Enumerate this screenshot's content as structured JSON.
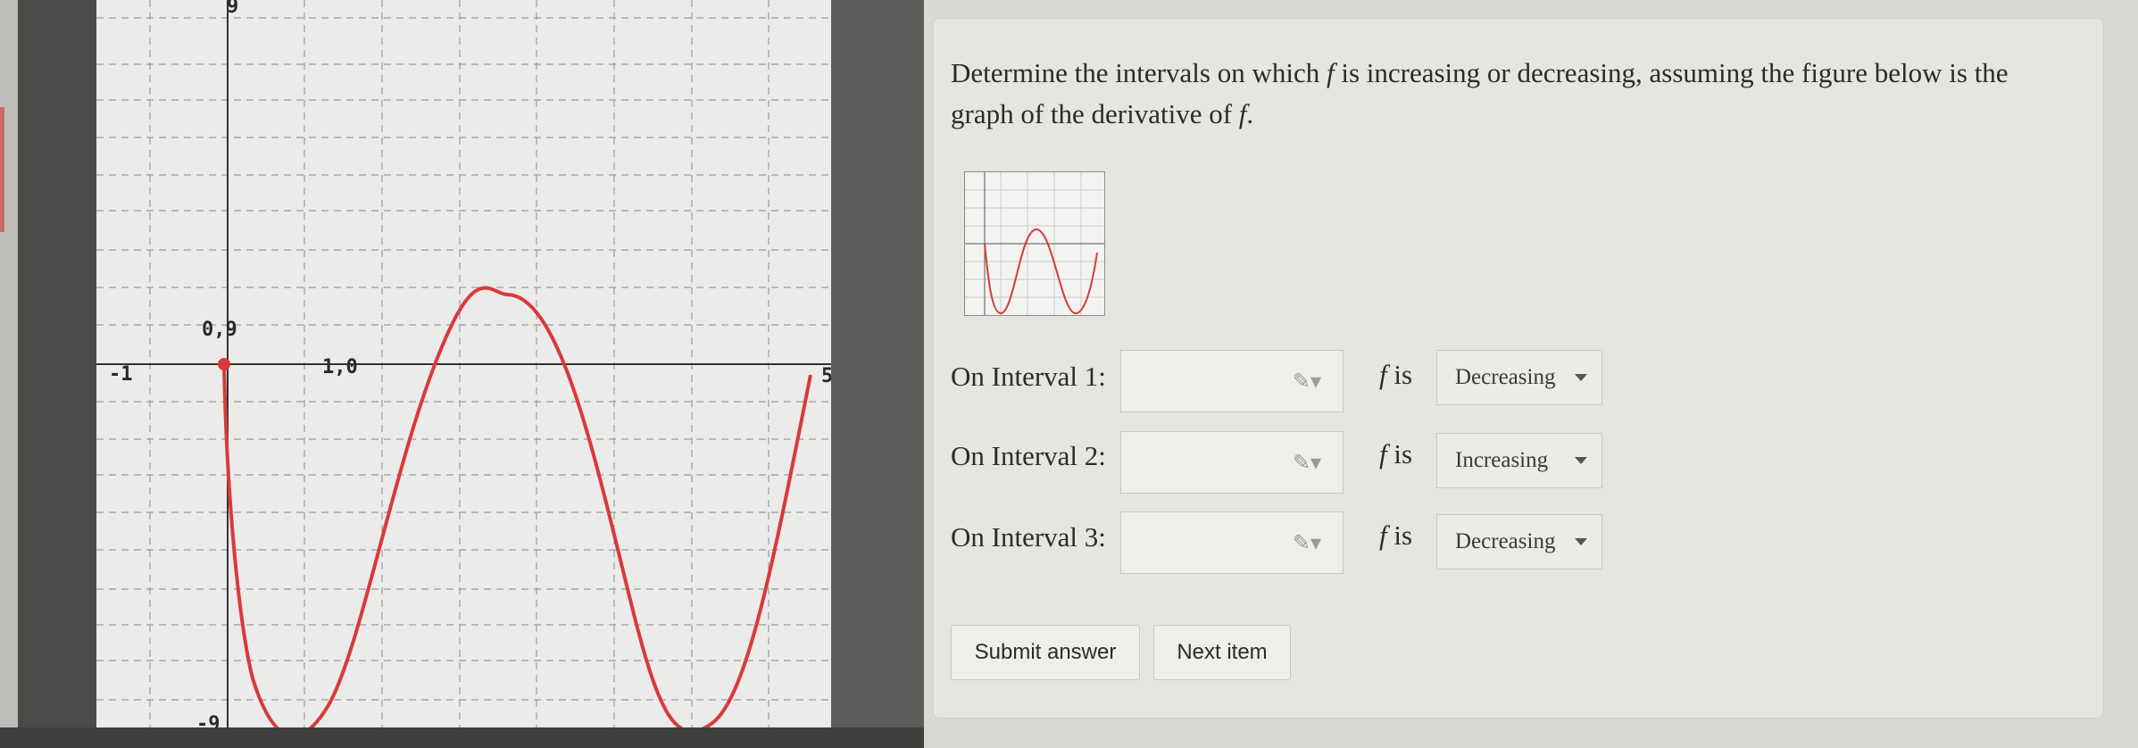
{
  "graph": {
    "tick_labels": {
      "x_min": "-1",
      "x_max": "5",
      "y_max": "9",
      "y_min": "-9",
      "point_a": "0,9",
      "point_b": "1,0"
    },
    "curve_color": "#d83a3a"
  },
  "question": {
    "text_before_f": "Determine the intervals on which ",
    "f": "f",
    "text_mid": " is increasing or decreasing, assuming the figure below is the graph of the derivative of ",
    "f2": "f",
    "text_end": "."
  },
  "intervals": [
    {
      "label": "On Interval 1:",
      "value": "",
      "fis_f": "f",
      "fis_is": " is",
      "selected": "Decreasing"
    },
    {
      "label": "On Interval 2:",
      "value": "",
      "fis_f": "f",
      "fis_is": " is",
      "selected": "Increasing"
    },
    {
      "label": "On Interval 3:",
      "value": "",
      "fis_f": "f",
      "fis_is": " is",
      "selected": "Decreasing"
    }
  ],
  "buttons": {
    "submit": "Submit answer",
    "next": "Next item"
  },
  "icons": {
    "answer_box": "pencil-dropdown-icon",
    "select": "caret-down-icon"
  }
}
